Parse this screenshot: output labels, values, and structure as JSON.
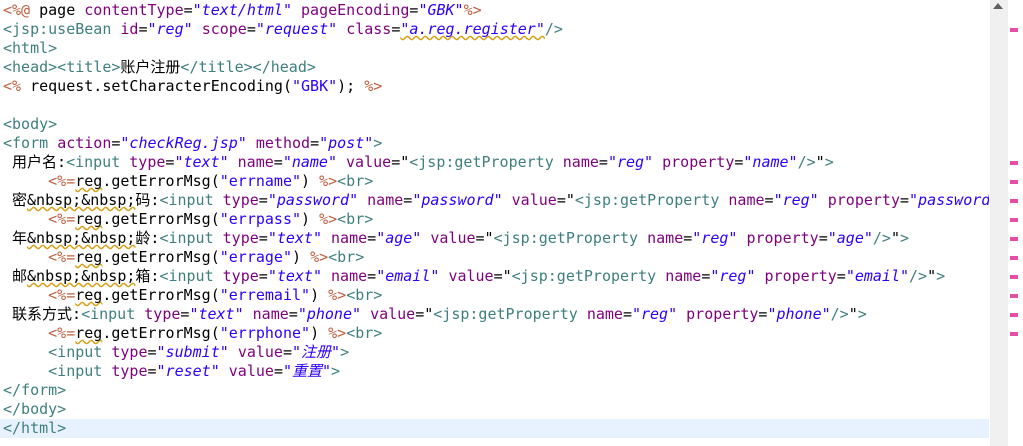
{
  "editor": {
    "lines": [
      [
        {
          "c": "d",
          "t": "<%@ "
        },
        {
          "c": "p",
          "t": "page "
        },
        {
          "c": "a",
          "t": "contentType"
        },
        {
          "c": "p",
          "t": "="
        },
        {
          "c": "v",
          "t": "\"text/html\""
        },
        {
          "c": "p",
          "t": " "
        },
        {
          "c": "a",
          "t": "pageEncoding"
        },
        {
          "c": "p",
          "t": "="
        },
        {
          "c": "v",
          "t": "\"GBK\""
        },
        {
          "c": "d",
          "t": "%>"
        }
      ],
      [
        {
          "c": "t",
          "t": "<jsp:useBean "
        },
        {
          "c": "a",
          "t": "id"
        },
        {
          "c": "p",
          "t": "="
        },
        {
          "c": "v",
          "t": "\"reg\""
        },
        {
          "c": "p",
          "t": " "
        },
        {
          "c": "a",
          "t": "scope"
        },
        {
          "c": "p",
          "t": "="
        },
        {
          "c": "v",
          "t": "\"request\""
        },
        {
          "c": "p",
          "t": " "
        },
        {
          "c": "a",
          "t": "class"
        },
        {
          "c": "p",
          "t": "="
        },
        {
          "c": "v u",
          "t": "\"a.reg.register\""
        },
        {
          "c": "t",
          "t": "/>"
        }
      ],
      [
        {
          "c": "t",
          "t": "<html>"
        }
      ],
      [
        {
          "c": "t",
          "t": "<head><title>"
        },
        {
          "c": "p",
          "t": "账户注册"
        },
        {
          "c": "t",
          "t": "</title></head>"
        }
      ],
      [
        {
          "c": "d",
          "t": "<% "
        },
        {
          "c": "p",
          "t": "request.setCharacterEncoding("
        },
        {
          "c": "s",
          "t": "\"GBK\""
        },
        {
          "c": "p",
          "t": "); "
        },
        {
          "c": "d",
          "t": "%>"
        }
      ],
      [],
      [
        {
          "c": "t",
          "t": "<body>"
        }
      ],
      [
        {
          "c": "t",
          "t": "<form "
        },
        {
          "c": "a",
          "t": "action"
        },
        {
          "c": "p",
          "t": "="
        },
        {
          "c": "v",
          "t": "\"checkReg.jsp\""
        },
        {
          "c": "p",
          "t": " "
        },
        {
          "c": "a",
          "t": "method"
        },
        {
          "c": "p",
          "t": "="
        },
        {
          "c": "v",
          "t": "\"post\""
        },
        {
          "c": "t",
          "t": ">"
        }
      ],
      [
        {
          "c": "p",
          "t": " 用户名:"
        },
        {
          "c": "t",
          "t": "<input "
        },
        {
          "c": "a",
          "t": "type"
        },
        {
          "c": "p",
          "t": "="
        },
        {
          "c": "v",
          "t": "\"text\""
        },
        {
          "c": "p",
          "t": " "
        },
        {
          "c": "a",
          "t": "name"
        },
        {
          "c": "p",
          "t": "="
        },
        {
          "c": "v",
          "t": "\"name\""
        },
        {
          "c": "p",
          "t": " "
        },
        {
          "c": "a",
          "t": "value"
        },
        {
          "c": "p",
          "t": "=\""
        },
        {
          "c": "t",
          "t": "<jsp:getProperty "
        },
        {
          "c": "a",
          "t": "name"
        },
        {
          "c": "p",
          "t": "="
        },
        {
          "c": "v",
          "t": "\"reg\""
        },
        {
          "c": "p",
          "t": " "
        },
        {
          "c": "a",
          "t": "property"
        },
        {
          "c": "p",
          "t": "="
        },
        {
          "c": "v",
          "t": "\"name\""
        },
        {
          "c": "t",
          "t": "/>"
        },
        {
          "c": "p",
          "t": "\""
        },
        {
          "c": "t",
          "t": ">"
        }
      ],
      [
        {
          "c": "p",
          "t": "     "
        },
        {
          "c": "d",
          "t": "<%="
        },
        {
          "c": "p u",
          "t": "reg"
        },
        {
          "c": "p",
          "t": ".getErrorMsg("
        },
        {
          "c": "s",
          "t": "\"errname\""
        },
        {
          "c": "p",
          "t": ") "
        },
        {
          "c": "d",
          "t": "%>"
        },
        {
          "c": "t",
          "t": "<br>"
        }
      ],
      [
        {
          "c": "p",
          "t": " 密"
        },
        {
          "c": "p u",
          "t": "&nbsp;&nbsp;"
        },
        {
          "c": "p",
          "t": "码:"
        },
        {
          "c": "t",
          "t": "<input "
        },
        {
          "c": "a",
          "t": "type"
        },
        {
          "c": "p",
          "t": "="
        },
        {
          "c": "v",
          "t": "\"password\""
        },
        {
          "c": "p",
          "t": " "
        },
        {
          "c": "a",
          "t": "name"
        },
        {
          "c": "p",
          "t": "="
        },
        {
          "c": "v",
          "t": "\"password\""
        },
        {
          "c": "p",
          "t": " "
        },
        {
          "c": "a",
          "t": "value"
        },
        {
          "c": "p",
          "t": "=\""
        },
        {
          "c": "t",
          "t": "<jsp:getProperty "
        },
        {
          "c": "a",
          "t": "name"
        },
        {
          "c": "p",
          "t": "="
        },
        {
          "c": "v",
          "t": "\"reg\""
        },
        {
          "c": "p",
          "t": " "
        },
        {
          "c": "a",
          "t": "property"
        },
        {
          "c": "p",
          "t": "="
        },
        {
          "c": "v",
          "t": "\"password"
        }
      ],
      [
        {
          "c": "p",
          "t": "     "
        },
        {
          "c": "d",
          "t": "<%="
        },
        {
          "c": "p u",
          "t": "reg"
        },
        {
          "c": "p",
          "t": ".getErrorMsg("
        },
        {
          "c": "s",
          "t": "\"errpass\""
        },
        {
          "c": "p",
          "t": ") "
        },
        {
          "c": "d",
          "t": "%>"
        },
        {
          "c": "t",
          "t": "<br>"
        }
      ],
      [
        {
          "c": "p",
          "t": " 年"
        },
        {
          "c": "p u",
          "t": "&nbsp;&nbsp;"
        },
        {
          "c": "p",
          "t": "龄:"
        },
        {
          "c": "t",
          "t": "<input "
        },
        {
          "c": "a",
          "t": "type"
        },
        {
          "c": "p",
          "t": "="
        },
        {
          "c": "v",
          "t": "\"text\""
        },
        {
          "c": "p",
          "t": " "
        },
        {
          "c": "a",
          "t": "name"
        },
        {
          "c": "p",
          "t": "="
        },
        {
          "c": "v",
          "t": "\"age\""
        },
        {
          "c": "p",
          "t": " "
        },
        {
          "c": "a",
          "t": "value"
        },
        {
          "c": "p",
          "t": "=\""
        },
        {
          "c": "t",
          "t": "<jsp:getProperty "
        },
        {
          "c": "a",
          "t": "name"
        },
        {
          "c": "p",
          "t": "="
        },
        {
          "c": "v",
          "t": "\"reg\""
        },
        {
          "c": "p",
          "t": " "
        },
        {
          "c": "a",
          "t": "property"
        },
        {
          "c": "p",
          "t": "="
        },
        {
          "c": "v",
          "t": "\"age\""
        },
        {
          "c": "t",
          "t": "/>"
        },
        {
          "c": "p",
          "t": "\""
        },
        {
          "c": "t",
          "t": ">"
        }
      ],
      [
        {
          "c": "p",
          "t": "     "
        },
        {
          "c": "d",
          "t": "<%="
        },
        {
          "c": "p u",
          "t": "reg"
        },
        {
          "c": "p",
          "t": ".getErrorMsg("
        },
        {
          "c": "s",
          "t": "\"errage\""
        },
        {
          "c": "p",
          "t": ") "
        },
        {
          "c": "d",
          "t": "%>"
        },
        {
          "c": "t",
          "t": "<br>"
        }
      ],
      [
        {
          "c": "p",
          "t": " 邮"
        },
        {
          "c": "p u",
          "t": "&nbsp;&nbsp;"
        },
        {
          "c": "p",
          "t": "箱:"
        },
        {
          "c": "t",
          "t": "<input "
        },
        {
          "c": "a",
          "t": "type"
        },
        {
          "c": "p",
          "t": "="
        },
        {
          "c": "v",
          "t": "\"text\""
        },
        {
          "c": "p",
          "t": " "
        },
        {
          "c": "a",
          "t": "name"
        },
        {
          "c": "p",
          "t": "="
        },
        {
          "c": "v",
          "t": "\"email\""
        },
        {
          "c": "p",
          "t": " "
        },
        {
          "c": "a",
          "t": "value"
        },
        {
          "c": "p",
          "t": "=\""
        },
        {
          "c": "t",
          "t": "<jsp:getProperty "
        },
        {
          "c": "a",
          "t": "name"
        },
        {
          "c": "p",
          "t": "="
        },
        {
          "c": "v",
          "t": "\"reg\""
        },
        {
          "c": "p",
          "t": " "
        },
        {
          "c": "a",
          "t": "property"
        },
        {
          "c": "p",
          "t": "="
        },
        {
          "c": "v",
          "t": "\"email\""
        },
        {
          "c": "t",
          "t": "/>"
        },
        {
          "c": "p",
          "t": "\""
        },
        {
          "c": "t",
          "t": ">"
        }
      ],
      [
        {
          "c": "p",
          "t": "     "
        },
        {
          "c": "d",
          "t": "<%="
        },
        {
          "c": "p u",
          "t": "reg"
        },
        {
          "c": "p",
          "t": ".getErrorMsg("
        },
        {
          "c": "s",
          "t": "\"erremail\""
        },
        {
          "c": "p",
          "t": ") "
        },
        {
          "c": "d",
          "t": "%>"
        },
        {
          "c": "t",
          "t": "<br>"
        }
      ],
      [
        {
          "c": "p",
          "t": " 联系方式:"
        },
        {
          "c": "t",
          "t": "<input "
        },
        {
          "c": "a",
          "t": "type"
        },
        {
          "c": "p",
          "t": "="
        },
        {
          "c": "v",
          "t": "\"text\""
        },
        {
          "c": "p",
          "t": " "
        },
        {
          "c": "a",
          "t": "name"
        },
        {
          "c": "p",
          "t": "="
        },
        {
          "c": "v",
          "t": "\"phone\""
        },
        {
          "c": "p",
          "t": " "
        },
        {
          "c": "a",
          "t": "value"
        },
        {
          "c": "p",
          "t": "=\""
        },
        {
          "c": "t",
          "t": "<jsp:getProperty "
        },
        {
          "c": "a",
          "t": "name"
        },
        {
          "c": "p",
          "t": "="
        },
        {
          "c": "v",
          "t": "\"reg\""
        },
        {
          "c": "p",
          "t": " "
        },
        {
          "c": "a",
          "t": "property"
        },
        {
          "c": "p",
          "t": "="
        },
        {
          "c": "v",
          "t": "\"phone\""
        },
        {
          "c": "t",
          "t": "/>"
        },
        {
          "c": "p",
          "t": "\""
        },
        {
          "c": "t",
          "t": ">"
        }
      ],
      [
        {
          "c": "p",
          "t": "     "
        },
        {
          "c": "d",
          "t": "<%="
        },
        {
          "c": "p u",
          "t": "reg"
        },
        {
          "c": "p",
          "t": ".getErrorMsg("
        },
        {
          "c": "s",
          "t": "\"errphone\""
        },
        {
          "c": "p",
          "t": ") "
        },
        {
          "c": "d",
          "t": "%>"
        },
        {
          "c": "t",
          "t": "<br>"
        }
      ],
      [
        {
          "c": "p",
          "t": "     "
        },
        {
          "c": "t",
          "t": "<input "
        },
        {
          "c": "a",
          "t": "type"
        },
        {
          "c": "p",
          "t": "="
        },
        {
          "c": "v",
          "t": "\"submit\""
        },
        {
          "c": "p",
          "t": " "
        },
        {
          "c": "a",
          "t": "value"
        },
        {
          "c": "p",
          "t": "="
        },
        {
          "c": "v",
          "t": "\"注册\""
        },
        {
          "c": "t",
          "t": ">"
        }
      ],
      [
        {
          "c": "p",
          "t": "     "
        },
        {
          "c": "t",
          "t": "<input "
        },
        {
          "c": "a",
          "t": "type"
        },
        {
          "c": "p",
          "t": "="
        },
        {
          "c": "v",
          "t": "\"reset\""
        },
        {
          "c": "p",
          "t": " "
        },
        {
          "c": "a",
          "t": "value"
        },
        {
          "c": "p",
          "t": "="
        },
        {
          "c": "v",
          "t": "\"重置\""
        },
        {
          "c": "t",
          "t": ">"
        }
      ],
      [
        {
          "c": "t",
          "t": "</form>"
        }
      ],
      [
        {
          "c": "t",
          "t": "</body>"
        }
      ],
      [
        {
          "c": "t",
          "t": "</html>"
        }
      ]
    ],
    "current_line": 22
  },
  "overview_ruler": {
    "marker_color": "#e24fa5",
    "markers_on_lines": [
      1,
      8,
      9,
      10,
      11,
      12,
      13,
      14,
      15,
      16,
      17
    ]
  }
}
